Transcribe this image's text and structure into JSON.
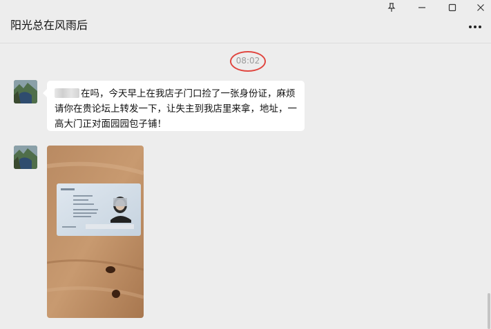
{
  "header": {
    "title": "阳光总在风雨后",
    "icons": [
      "pin-icon",
      "minimize-icon",
      "maximize-icon",
      "close-icon",
      "more-icon"
    ]
  },
  "chat": {
    "timestamp": "08:02",
    "messages": [
      {
        "type": "text",
        "text": "在吗，今天早上在我店子门口捡了一张身份证，麻烦请你在贵论坛上转发一下，让失主到我店里来拿，地址，一高大门正对面园园包子铺！"
      },
      {
        "type": "image",
        "description_icon": "id-card-photo"
      }
    ]
  },
  "colors": {
    "background": "#ededed",
    "bubble": "#ffffff",
    "highlight_ring": "#e0463f",
    "timestamp_text": "#9a9a9a"
  }
}
